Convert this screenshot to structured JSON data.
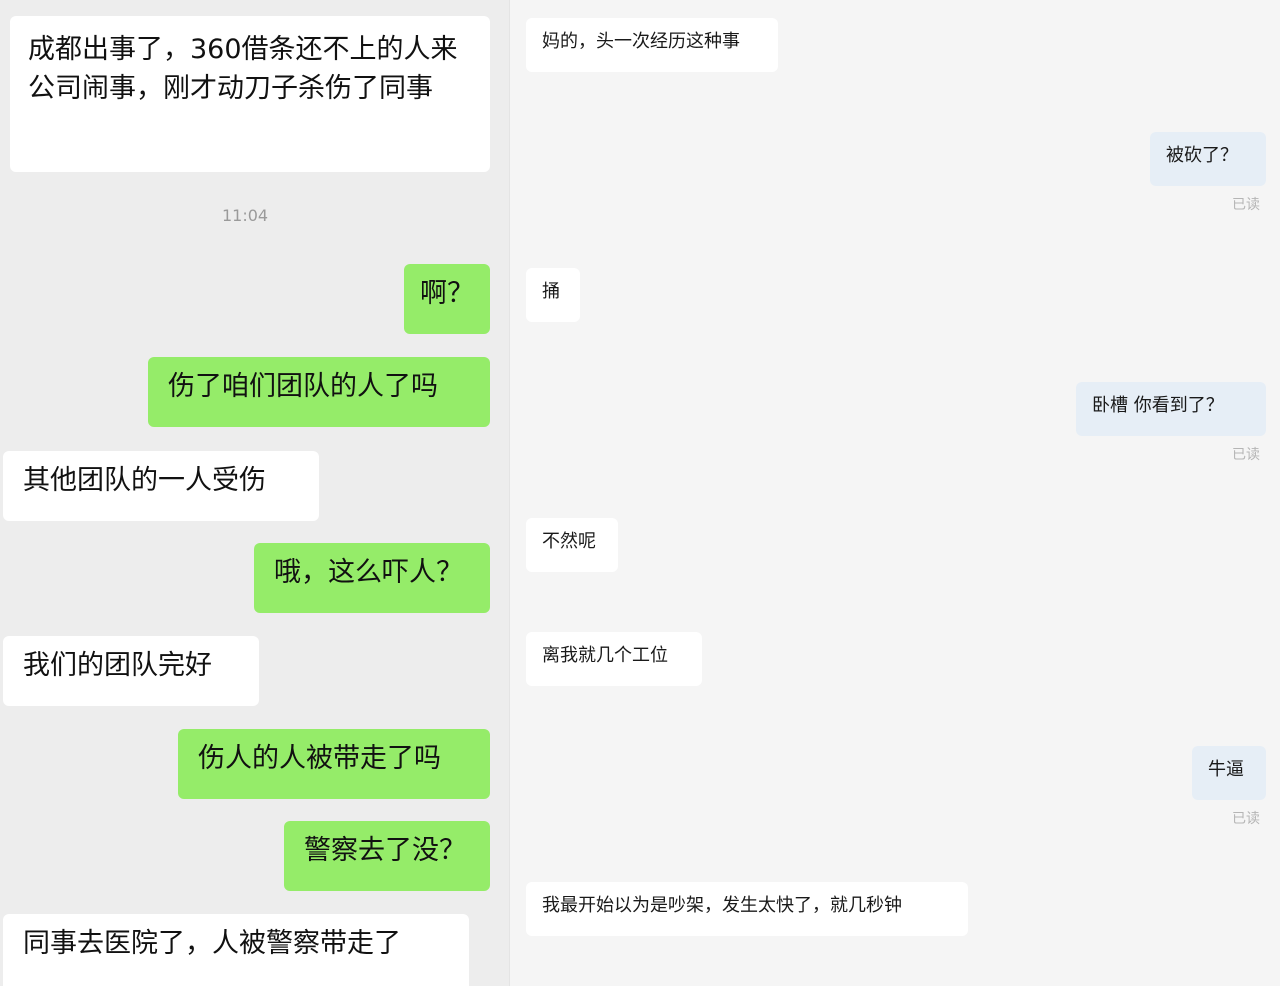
{
  "left_chat": {
    "time": "11:04",
    "messages": [
      {
        "side": "in",
        "text": "成都出事了，360借条还不上的人来公司闹事，刚才动刀子杀伤了同事"
      },
      {
        "side": "out",
        "text": "啊？"
      },
      {
        "side": "out",
        "text": "伤了咱们团队的人了吗"
      },
      {
        "side": "in",
        "text": "其他团队的一人受伤"
      },
      {
        "side": "out",
        "text": "哦，这么吓人？"
      },
      {
        "side": "in",
        "text": "我们的团队完好"
      },
      {
        "side": "out",
        "text": "伤人的人被带走了吗"
      },
      {
        "side": "out",
        "text": "警察去了没？"
      },
      {
        "side": "in",
        "text": "同事去医院了，人被警察带走了"
      }
    ]
  },
  "right_chat": {
    "messages": [
      {
        "side": "in",
        "text": "妈的，头一次经历这种事"
      },
      {
        "side": "out",
        "text": "被砍了？",
        "status": "已读"
      },
      {
        "side": "in",
        "text": "捅"
      },
      {
        "side": "out",
        "text": "卧槽 你看到了？",
        "status": "已读"
      },
      {
        "side": "in",
        "text": "不然呢"
      },
      {
        "side": "in",
        "text": "离我就几个工位"
      },
      {
        "side": "out",
        "text": "牛逼",
        "status": "已读"
      },
      {
        "side": "in",
        "text": "我最开始以为是吵架，发生太快了，就几秒钟"
      }
    ]
  },
  "colors": {
    "left_background": "#ededed",
    "right_background": "#f5f5f5",
    "incoming_bubble": "#ffffff",
    "outgoing_bubble": "#95ec69",
    "right_outgoing_bubble": "#e6eef6"
  }
}
